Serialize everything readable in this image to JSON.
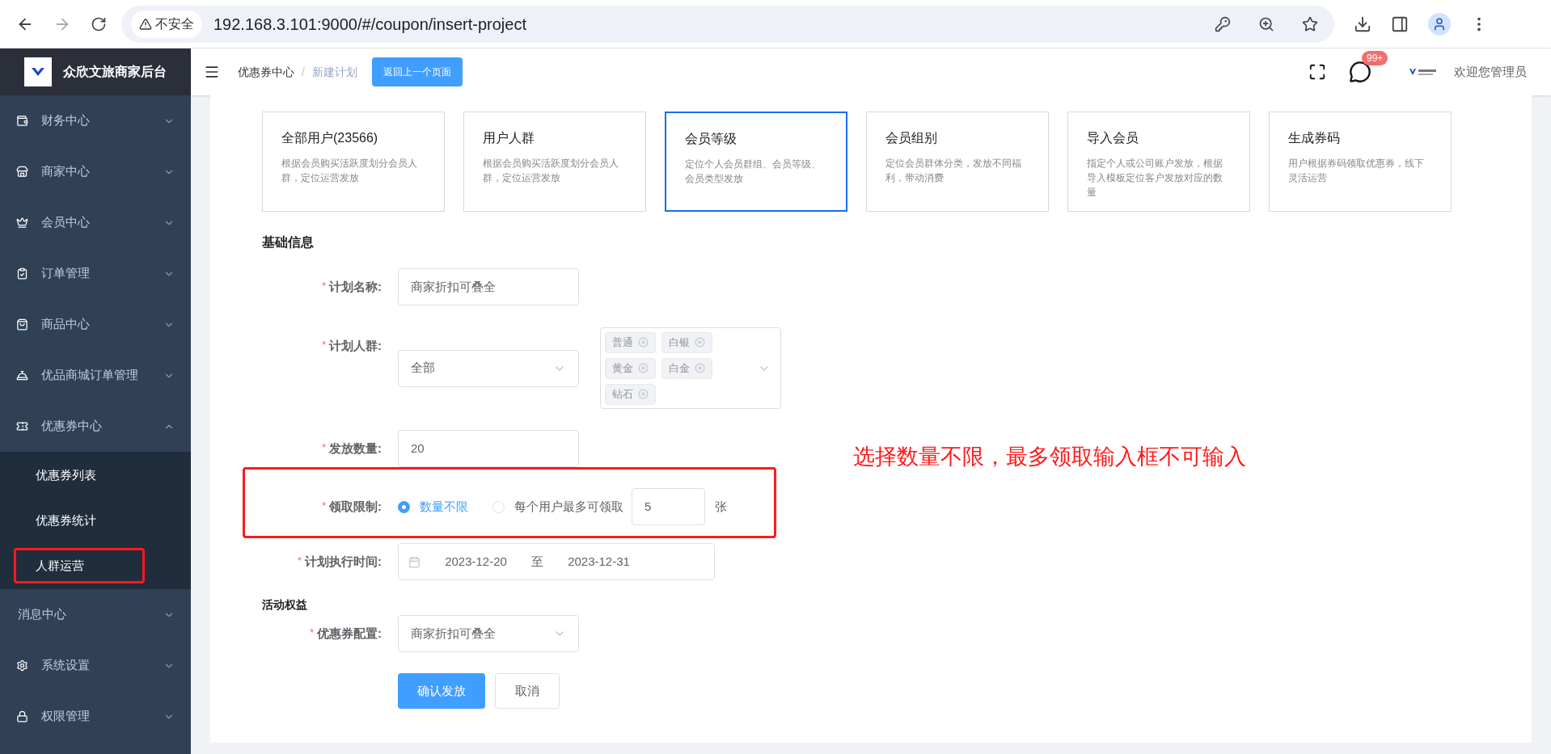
{
  "browser": {
    "insecure_label": "不安全",
    "url": "192.168.3.101:9000/#/coupon/insert-project"
  },
  "sidebar": {
    "title": "众欣文旅商家后台",
    "items": [
      {
        "label": "财务中心",
        "expanded": false
      },
      {
        "label": "商家中心",
        "expanded": false
      },
      {
        "label": "会员中心",
        "expanded": false
      },
      {
        "label": "订单管理",
        "expanded": false
      },
      {
        "label": "商品中心",
        "expanded": false
      },
      {
        "label": "优品商城订单管理",
        "expanded": false
      },
      {
        "label": "优惠券中心",
        "expanded": true,
        "children": [
          {
            "label": "优惠券列表",
            "highlighted": false
          },
          {
            "label": "优惠券统计",
            "highlighted": false
          },
          {
            "label": "人群运营",
            "highlighted": true
          }
        ]
      },
      {
        "label": "消息中心",
        "expanded": false
      },
      {
        "label": "系统设置",
        "expanded": false
      },
      {
        "label": "权限管理",
        "expanded": false
      }
    ]
  },
  "header": {
    "breadcrumb": [
      "优惠券中心",
      "新建计划"
    ],
    "breadcrumb_separator": "/",
    "back_button": "返回上一个页面",
    "badge": "99+",
    "welcome": "欢迎您管理员"
  },
  "plan_types": [
    {
      "title": "全部用户(23566)",
      "description": "根据会员购买活跃度划分会员人群，定位运营发放",
      "selected": false
    },
    {
      "title": "用户人群",
      "description": "根据会员购买活跃度划分会员人群，定位运营发放",
      "selected": false
    },
    {
      "title": "会员等级",
      "description": "定位个人会员群组、会员等级、会员类型发放",
      "selected": true
    },
    {
      "title": "会员组别",
      "description": "定位会员群体分类，发放不同福利，带动消费",
      "selected": false
    },
    {
      "title": "导入会员",
      "description": "指定个人或公司账户发放，根据导入模板定位客户发放对应的数量",
      "selected": false
    },
    {
      "title": "生成券码",
      "description": "用户根据券码领取优惠券，线下灵活运营",
      "selected": false
    }
  ],
  "basic_info": {
    "title": "基础信息",
    "rows": [
      {
        "kind": "input",
        "required_mark": "*",
        "label": "计划名称:",
        "value": "商家折扣可叠全",
        "highlighted": false
      },
      {
        "kind": "crowd",
        "required_mark": "*",
        "label": "计划人群:",
        "value": "全部",
        "tags": [
          "普通",
          "白银",
          "黄金",
          "白金",
          "钻石"
        ],
        "highlighted": false
      },
      {
        "kind": "input",
        "required_mark": "*",
        "label": "发放数量:",
        "value": "20",
        "highlighted": false
      },
      {
        "kind": "limit",
        "required_mark": "*",
        "label": "领取限制:",
        "options": [
          {
            "label": "数量不限",
            "selected": true
          },
          {
            "label": "每个用户最多可领取",
            "selected": false
          }
        ],
        "value": "5",
        "unit": "张",
        "highlighted": true
      },
      {
        "kind": "daterange",
        "required_mark": "*",
        "label": "计划执行时间:",
        "start": "2023-12-20",
        "separator": "至",
        "end": "2023-12-31",
        "highlighted": false
      }
    ]
  },
  "benefits": {
    "title": "活动权益",
    "rows": [
      {
        "kind": "select",
        "required_mark": "*",
        "label": "优惠券配置:",
        "value": "商家折扣可叠全",
        "highlighted": false
      }
    ]
  },
  "buttons": [
    {
      "label": "确认发放",
      "primary": true
    },
    {
      "label": "取消",
      "primary": false
    }
  ],
  "annotation": {
    "text": "选择数量不限，最多领取输入框不可输入"
  }
}
